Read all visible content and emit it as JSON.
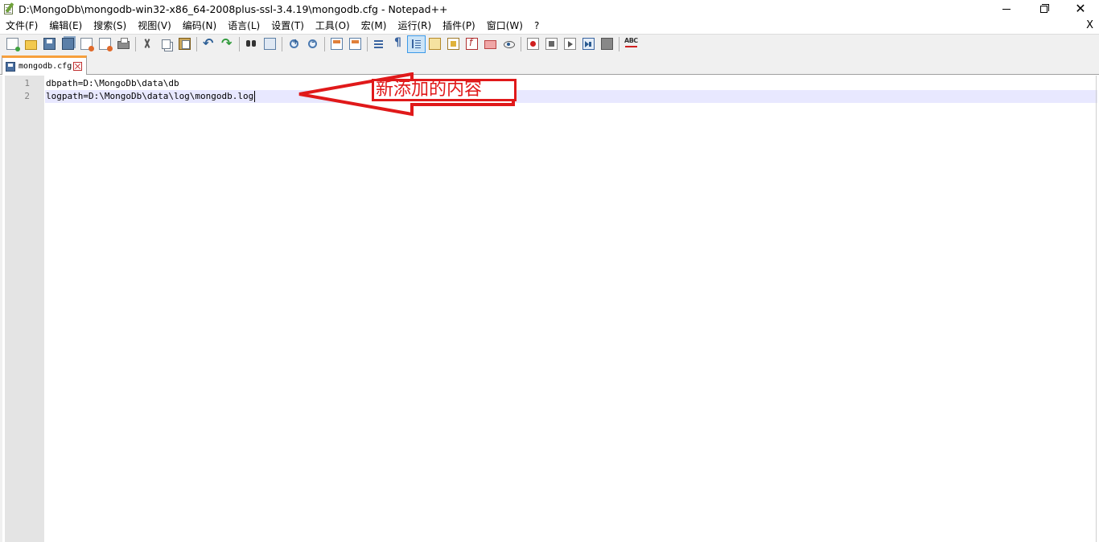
{
  "window": {
    "title": "D:\\MongoDb\\mongodb-win32-x86_64-2008plus-ssl-3.4.19\\mongodb.cfg - Notepad++",
    "minimize_label": "",
    "close_label": "✕"
  },
  "menu": {
    "items": [
      {
        "label": "文件(F)"
      },
      {
        "label": "编辑(E)"
      },
      {
        "label": "搜索(S)"
      },
      {
        "label": "视图(V)"
      },
      {
        "label": "编码(N)"
      },
      {
        "label": "语言(L)"
      },
      {
        "label": "设置(T)"
      },
      {
        "label": "工具(O)"
      },
      {
        "label": "宏(M)"
      },
      {
        "label": "运行(R)"
      },
      {
        "label": "插件(P)"
      },
      {
        "label": "窗口(W)"
      },
      {
        "label": "?"
      }
    ],
    "close_doc_label": "X"
  },
  "toolbar": {
    "icons": [
      "new-file-icon",
      "open-file-icon",
      "save-icon",
      "save-all-icon",
      "close-icon",
      "close-all-icon",
      "print-icon",
      "cut-icon",
      "copy-icon",
      "paste-icon",
      "undo-icon",
      "redo-icon",
      "find-icon",
      "replace-icon",
      "zoom-in-icon",
      "zoom-out-icon",
      "sync-vertical-icon",
      "sync-horizontal-icon",
      "word-wrap-icon",
      "show-all-chars-icon",
      "indent-guide-icon",
      "user-defined-language-icon",
      "document-map-icon",
      "function-list-icon",
      "folder-as-workspace-icon",
      "monitoring-icon",
      "record-macro-icon",
      "stop-recording-icon",
      "playback-icon",
      "run-macro-multiple-icon",
      "save-macro-icon",
      "spell-check-icon"
    ],
    "active": "indent-guide-icon"
  },
  "tab": {
    "label": "mongodb.cfg",
    "accent_color": "#f7a03c"
  },
  "editor": {
    "lines": [
      {
        "number": "1",
        "text": "dbpath=D:\\MongoDb\\data\\db"
      },
      {
        "number": "2",
        "text": "logpath=D:\\MongoDb\\data\\log\\mongodb.log"
      }
    ],
    "current_line_color": "#e8e8ff"
  },
  "annotation": {
    "label": "新添加的内容",
    "color": "#e0191a"
  }
}
